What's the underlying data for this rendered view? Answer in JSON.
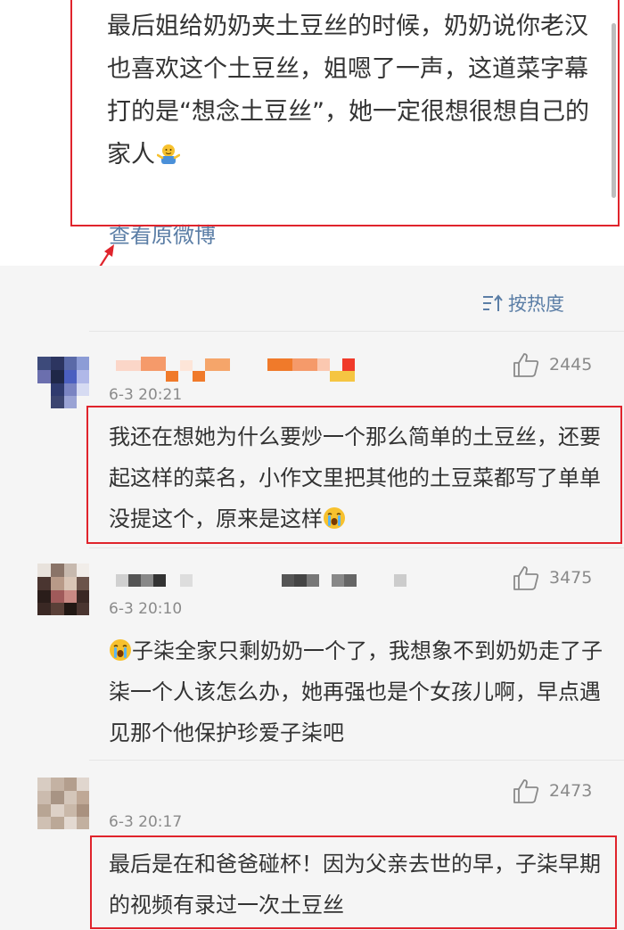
{
  "post": {
    "text": "最后姐给奶奶夹土豆丝的时候，奶奶说你老汉也喜欢这个土豆丝，姐嗯了一声，这道菜字幕打的是“想念土豆丝”，她一定很想很想自己的家人",
    "emoji": "shrug-emoji",
    "view_original_label": "查看原微博"
  },
  "sort": {
    "label": "按热度",
    "icon": "sort-icon"
  },
  "comments": [
    {
      "time": "6-3 20:21",
      "likes": "2445",
      "text": "我还在想她为什么要炒一个那么简单的土豆丝，还要起这样的菜名，小作文里把其他的土豆菜都写了单单没提这个，原来是这样",
      "emoji": "crying-emoji"
    },
    {
      "time": "6-3 20:10",
      "likes": "3475",
      "text": "子柒全家只剩奶奶一个了，我想象不到奶奶走了子柒一个人该怎么办，她再强也是个女孩儿啊，早点遇见那个他保护珍爱子柒吧",
      "emoji": "crying-emoji"
    },
    {
      "time": "6-3 20:17",
      "likes": "2473",
      "text": "最后是在和爸爸碰杯！因为父亲去世的早，子柒早期的视频有录过一次土豆丝"
    }
  ],
  "colors": {
    "highlight_box": "#e0242c",
    "link": "#5b7ea6",
    "muted": "#8a8a8a",
    "comments_bg": "#f5f5f5"
  }
}
